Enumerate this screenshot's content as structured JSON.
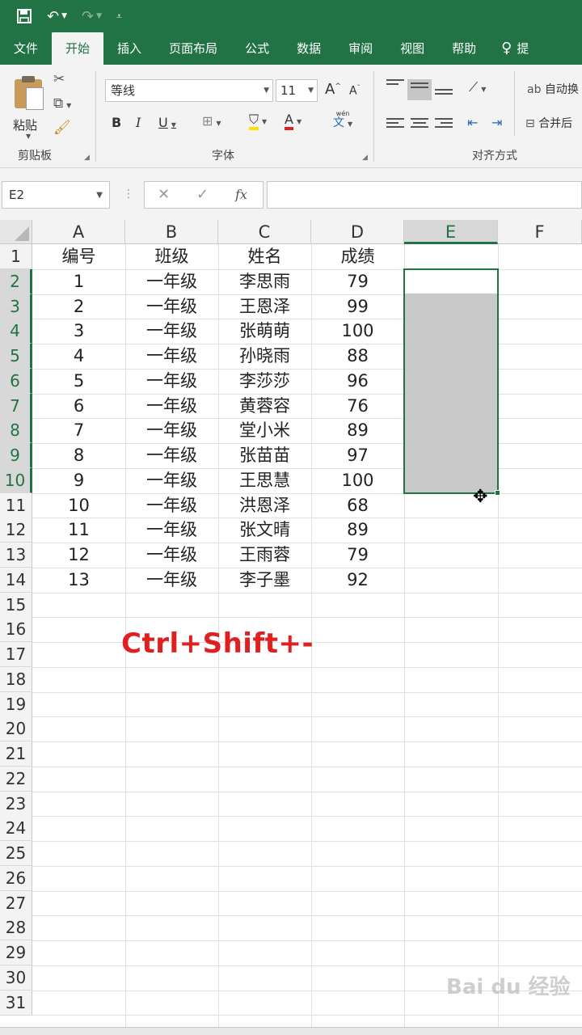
{
  "quick_access": {
    "save": "save-icon",
    "undo": "undo-icon",
    "redo": "redo-icon",
    "customize": "customize-icon"
  },
  "tabs": [
    "文件",
    "开始",
    "插入",
    "页面布局",
    "公式",
    "数据",
    "审阅",
    "视图",
    "帮助",
    "提"
  ],
  "ribbon": {
    "clipboard": {
      "paste_label": "粘贴",
      "group_label": "剪贴板"
    },
    "font": {
      "font_name": "等线",
      "font_size": "11",
      "group_label": "字体",
      "bold": "B",
      "italic": "I",
      "underline": "U",
      "grow": "A",
      "shrink": "A",
      "color_a": "A",
      "phonetic_top": "wén",
      "phonetic": "文"
    },
    "alignment": {
      "wrap_text": "自动换",
      "merge": "合并后",
      "group_label": "对齐方式"
    }
  },
  "formula_bar": {
    "name_box": "E2",
    "fx": "fx",
    "value": ""
  },
  "columns": [
    "A",
    "B",
    "C",
    "D",
    "E",
    "F"
  ],
  "rows": [
    "1",
    "2",
    "3",
    "4",
    "5",
    "6",
    "7",
    "8",
    "9",
    "10",
    "11",
    "12",
    "13",
    "14",
    "15",
    "16",
    "17",
    "18",
    "19",
    "20",
    "21",
    "22",
    "23",
    "24",
    "25",
    "26",
    "27",
    "28",
    "29",
    "30",
    "31"
  ],
  "table": {
    "headers": [
      "编号",
      "班级",
      "姓名",
      "成绩"
    ],
    "rows": [
      [
        "1",
        "一年级",
        "李思雨",
        "79"
      ],
      [
        "2",
        "一年级",
        "王恩泽",
        "99"
      ],
      [
        "3",
        "一年级",
        "张萌萌",
        "100"
      ],
      [
        "4",
        "一年级",
        "孙晓雨",
        "88"
      ],
      [
        "5",
        "一年级",
        "李莎莎",
        "96"
      ],
      [
        "6",
        "一年级",
        "黄蓉容",
        "76"
      ],
      [
        "7",
        "一年级",
        "堂小米",
        "89"
      ],
      [
        "8",
        "一年级",
        "张苗苗",
        "97"
      ],
      [
        "9",
        "一年级",
        "王思慧",
        "100"
      ],
      [
        "10",
        "一年级",
        "洪恩泽",
        "68"
      ],
      [
        "11",
        "一年级",
        "张文晴",
        "89"
      ],
      [
        "12",
        "一年级",
        "王雨蓉",
        "79"
      ],
      [
        "13",
        "一年级",
        "李子墨",
        "92"
      ]
    ]
  },
  "selection": {
    "range": "E2:E10",
    "active": "E2"
  },
  "overlay": {
    "shortcut": "Ctrl+Shift+-",
    "watermark": "Bai du 经验"
  },
  "colors": {
    "accent": "#217346",
    "selection_fill": "#c9c9c9",
    "shortcut_text": "#e02020"
  }
}
